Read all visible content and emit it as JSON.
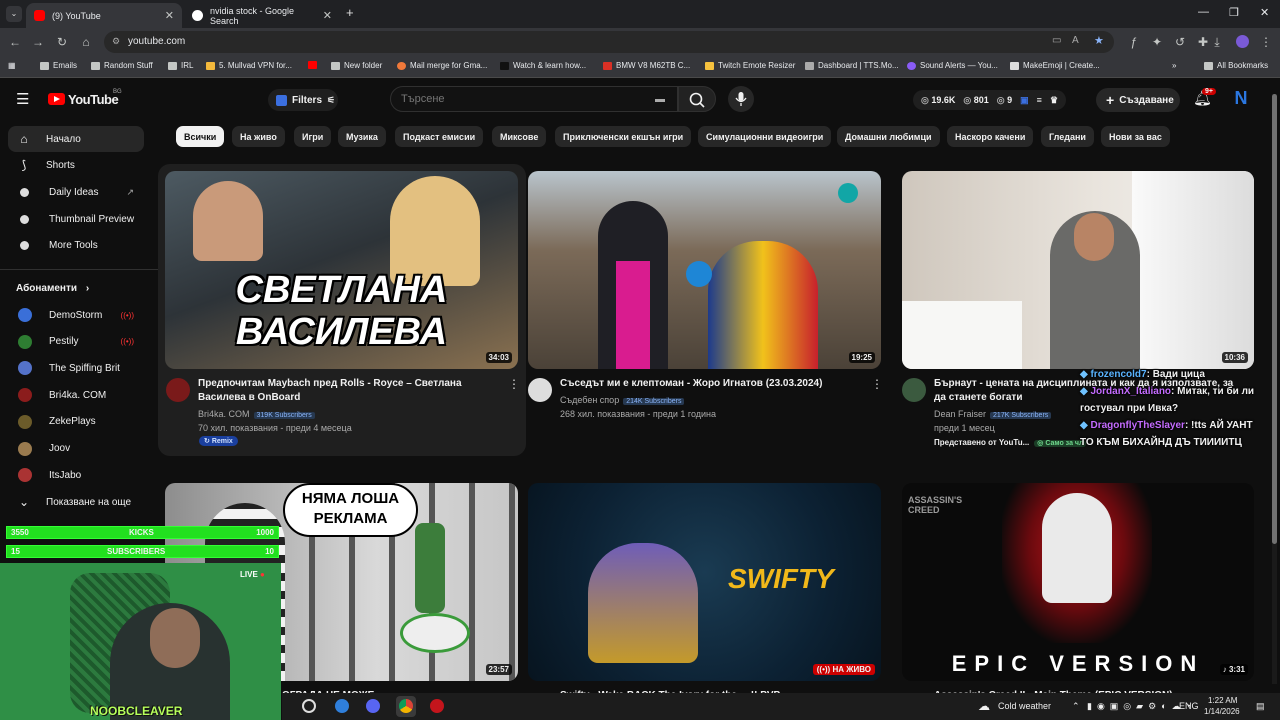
{
  "browser": {
    "tabs": [
      {
        "title": "(9) YouTube",
        "active": true
      },
      {
        "title": "nvidia stock - Google Search",
        "active": false
      }
    ],
    "url": "youtube.com",
    "bookmarks": [
      "Emails",
      "Random Stuff",
      "IRL",
      "5. Mullvad VPN for...",
      "New folder",
      "Mail merge for Gma...",
      "Watch & learn how...",
      "BMW V8 M62TB C...",
      "Twitch Emote Resizer",
      "Dashboard | TTS.Mo...",
      "Sound Alerts — You...",
      "MakeEmoji | Create..."
    ],
    "all_bookmarks": "All Bookmarks"
  },
  "header": {
    "logo": "YouTube",
    "country": "BG",
    "filters": "Filters",
    "search_placeholder": "Търсене",
    "stats": [
      "19.6K",
      "801",
      "9"
    ],
    "create": "Създаване",
    "notif_badge": "9+",
    "avatar_letter": "N"
  },
  "sidebar": {
    "items": [
      {
        "label": "Начало"
      },
      {
        "label": "Shorts"
      },
      {
        "label": "Daily Ideas"
      },
      {
        "label": "Thumbnail Preview"
      },
      {
        "label": "More Tools"
      }
    ],
    "subs_heading": "Абонаменти",
    "subscriptions": [
      {
        "label": "DemoStorm",
        "live": true,
        "color": "#3a6fd8"
      },
      {
        "label": "Pestily",
        "live": true,
        "color": "#2e7d32"
      },
      {
        "label": "The Spiffing Brit",
        "live": false,
        "color": "#5472c9"
      },
      {
        "label": "Bri4ka. COM",
        "live": false,
        "color": "#8b1c1c"
      },
      {
        "label": "ZekePlays",
        "live": false,
        "color": "#6b5b2a"
      },
      {
        "label": "Joov",
        "live": false,
        "color": "#9a7b4f"
      },
      {
        "label": "ItsJabo",
        "live": false,
        "color": "#a33"
      }
    ],
    "show_more": "Показване на още"
  },
  "chips": [
    "Всички",
    "На живо",
    "Игри",
    "Музика",
    "Подкаст емисии",
    "Миксове",
    "Приключенски екшън игри",
    "Симулационни видеоигри",
    "Домашни любимци",
    "Наскоро качени",
    "Гледани",
    "Нови за вас"
  ],
  "videos": [
    {
      "thumb_title_line1": "СВЕТЛАНА",
      "thumb_title_line2": "ВАСИЛЕВА",
      "duration": "34:03",
      "title": "Предпочитам Maybach пред Rolls - Royce – Светлана Василева в OnBoard",
      "channel": "Bri4ka. COM",
      "subs": "319K Subscribers",
      "meta": "70 хил. показвания - преди 4 месеца",
      "badge": "Remix"
    },
    {
      "duration": "19:25",
      "title": "Съседът ми е клептоман - Жоро Игнатов (23.03.2024)",
      "channel": "Съдебен спор",
      "subs": "214K Subscribers",
      "meta": "268 хил. показвания - преди 1 година"
    },
    {
      "duration": "10:36",
      "title": "Бърнаут - цената на дисциплината и как да я използвате, за да станете богати",
      "channel": "Dean Fraiser",
      "subs": "217K Subscribers",
      "meta": "преди 1 месец",
      "promo": "Представено от YouTu...",
      "promo_badge": "Само за чл"
    },
    {
      "thumb_title_line1": "НЯМА ЛОША",
      "thumb_title_line2": "РЕКЛАМА",
      "duration": "23:57",
      "title": "ОГРАДА НЕ МОЖЕ"
    },
    {
      "thumb_text": "SWIFTY",
      "live_badge": "НА ЖИВО",
      "title": "Swifty - Wake BACK The Ivory for the ... !! PVP"
    },
    {
      "thumb_text": "EPIC VERSION",
      "thumb_brand": "ASSASSIN'S CREED",
      "duration": "3:31",
      "title": "Assassin's Creed II - Main Theme (EPIC VERSION)"
    }
  ],
  "chat": [
    {
      "user": "frozencold7",
      "color": "#5ab4ff",
      "text": ": Вади цица"
    },
    {
      "user": "JordanX_Italiano",
      "color": "#c46cff",
      "text": ": Митак, ти би ли гостувал при Ивка?"
    },
    {
      "user": "DragonflyTheSlayer",
      "color": "#c46cff",
      "text": ": !tts АЙ УАНТ ТО КЪМ БИХАЙНД ДЪ ТИИИИТЦ"
    }
  ],
  "overlay": {
    "kicks_value": "3550",
    "kicks_label": "KICKS",
    "kicks_goal": "1000",
    "subs_value": "15",
    "subs_label": "SUBSCRIBERS",
    "subs_goal": "10",
    "live_label": "LIVE",
    "streamer": "NOOBCLEAVER"
  },
  "taskbar": {
    "weather": "Cold weather",
    "lang": "ENG",
    "time": "1:22 AM",
    "date": "1/14/2026"
  }
}
